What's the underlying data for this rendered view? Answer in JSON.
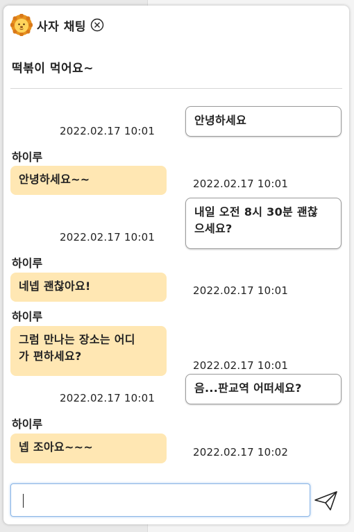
{
  "chat": {
    "title": "사자 채팅",
    "subtitle": "떡볶이 먹어요~",
    "input_value": "",
    "messages": [
      {
        "type": "sent",
        "text": "안녕하세요",
        "time": "2022.02.17 10:01"
      },
      {
        "type": "recv",
        "sender": "하이루",
        "text": "안녕하세요~~",
        "time": "2022.02.17 10:01"
      },
      {
        "type": "sent",
        "text_lines": [
          "내일 오전 8시 30분 괜찮",
          "으세요?"
        ],
        "time": "2022.02.17 10:01"
      },
      {
        "type": "recv",
        "sender": "하이루",
        "text": "네넵 괜찮아요!",
        "time": "2022.02.17 10:01"
      },
      {
        "type": "recv",
        "sender": "하이루",
        "text_lines": [
          "그럼 만나는 장소는 어디",
          "가 편하세요?"
        ],
        "time": "2022.02.17 10:01"
      },
      {
        "type": "sent",
        "text": "음...판교역 어떠세요?",
        "time": "2022.02.17 10:01"
      },
      {
        "type": "recv",
        "sender": "하이루",
        "text": "넵 조아요~~~",
        "time": "2022.02.17 10:02"
      }
    ]
  },
  "icons": {
    "header": "lion-icon",
    "close": "close-icon",
    "send": "send-icon"
  },
  "colors": {
    "received_bubble": "#ffe7b3",
    "sent_bubble": "#ffffff",
    "input_border": "#8cb6e6"
  }
}
